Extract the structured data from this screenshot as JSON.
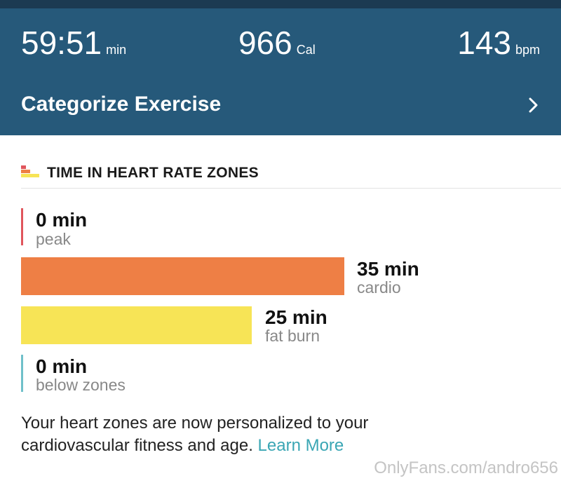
{
  "summary": {
    "duration": {
      "value": "59:51",
      "unit": "min"
    },
    "calories": {
      "value": "966",
      "unit": "Cal"
    },
    "heart_rate": {
      "value": "143",
      "unit": "bpm"
    }
  },
  "categorize": {
    "label": "Categorize Exercise",
    "icon": "chevron-right-icon"
  },
  "zones_section": {
    "title": "TIME IN HEART RATE ZONES",
    "icon": "heart-rate-zones-icon",
    "scale_max_min": 35,
    "zones": [
      {
        "id": "peak",
        "value": "0 min",
        "label": "peak",
        "minutes": 0,
        "color": "#e0555c"
      },
      {
        "id": "cardio",
        "value": "35 min",
        "label": "cardio",
        "minutes": 35,
        "color": "#ee7f45"
      },
      {
        "id": "fat-burn",
        "value": "25 min",
        "label": "fat burn",
        "minutes": 25,
        "color": "#f7e456"
      },
      {
        "id": "below-zones",
        "value": "0 min",
        "label": "below zones",
        "minutes": 0,
        "color": "#6fc0ca"
      }
    ]
  },
  "footnote": {
    "text": "Your heart zones are now personalized to your cardiovascular fitness and age.",
    "link": "Learn More"
  },
  "watermark": "OnlyFans.com/andro656",
  "colors": {
    "header_bg": "#26597a",
    "top_bar": "#1c3a52",
    "link": "#3aa6b4"
  }
}
